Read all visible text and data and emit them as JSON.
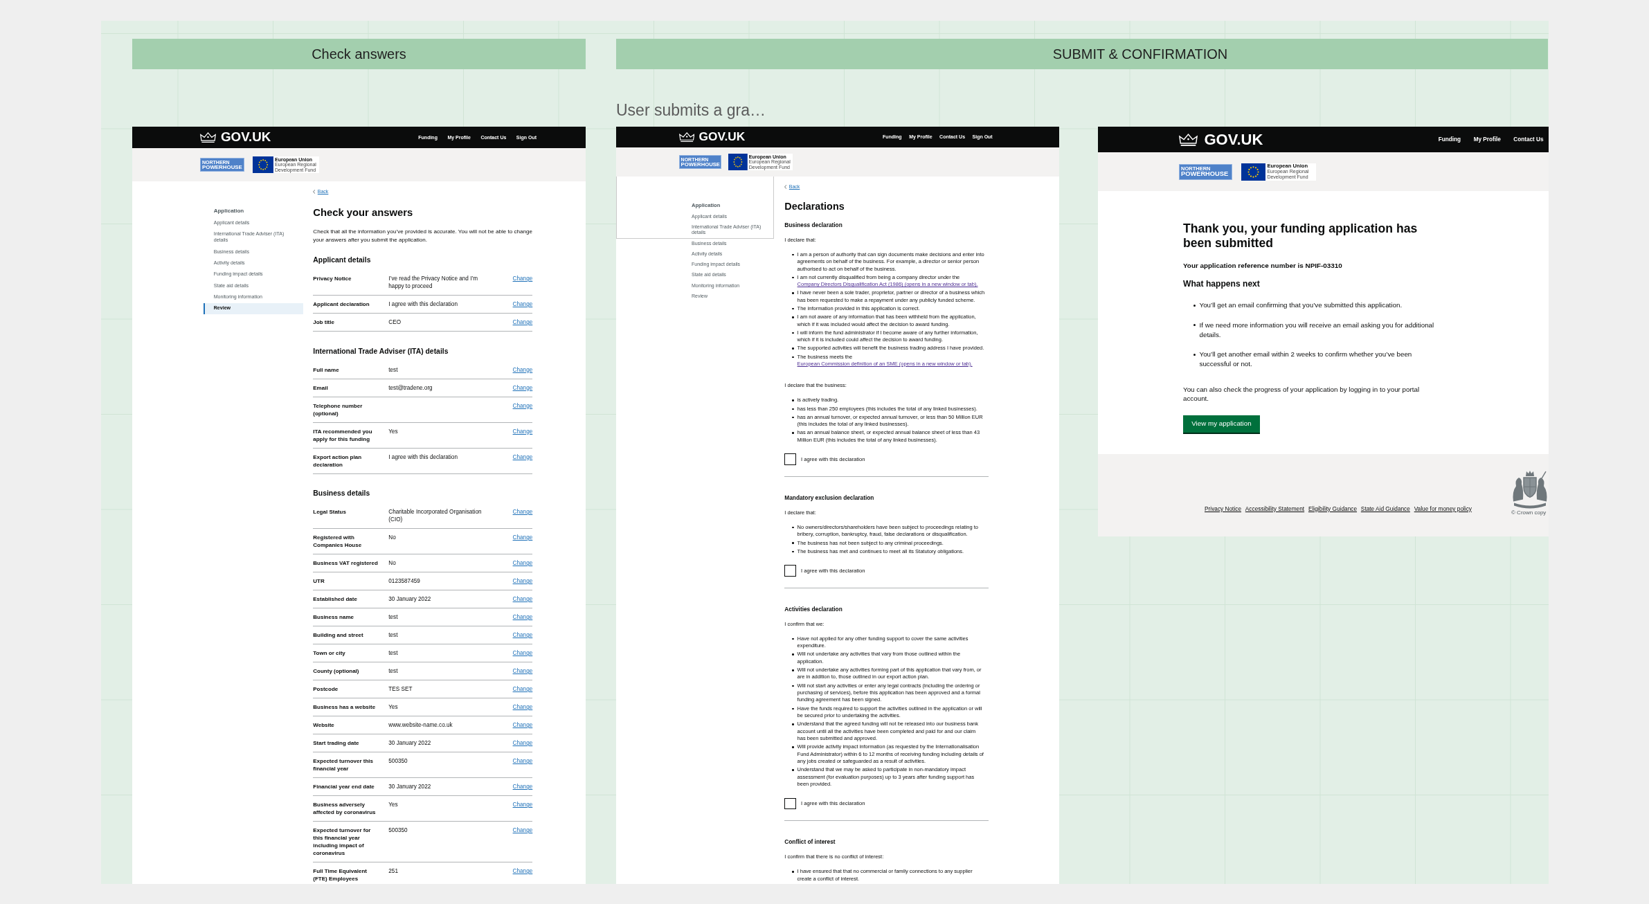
{
  "lanes": [
    {
      "title": "Check answers"
    },
    {
      "title": "SUBMIT & CONFIRMATION"
    }
  ],
  "caption": "User submits a gra…",
  "screens": [
    {
      "kind": "check_answers",
      "header": {
        "logo": "GOV.UK",
        "nav": [
          "Funding",
          "My Profile",
          "Contact Us",
          "Sign Out"
        ]
      },
      "banner": {
        "partner": [
          "NORTHERN",
          "POWERHOUSE"
        ],
        "eu": [
          "European Union",
          "European Regional",
          "Development Fund"
        ]
      },
      "back_link": "Back",
      "sidebar": {
        "title": "Application",
        "items": [
          {
            "label": "Applicant details",
            "selected": false
          },
          {
            "label": "International Trade Adviser (ITA) details",
            "selected": false
          },
          {
            "label": "Business details",
            "selected": false
          },
          {
            "label": "Activity details",
            "selected": false
          },
          {
            "label": "Funding impact details",
            "selected": false
          },
          {
            "label": "State aid details",
            "selected": false
          },
          {
            "label": "Monitoring information",
            "selected": false
          },
          {
            "label": "Review",
            "selected": true
          }
        ]
      },
      "title": "Check your answers",
      "intro": "Check that all the information you’ve provided is accurate. You will not be able to change your answers after you submit the application.",
      "sections": [
        {
          "heading": "Applicant details",
          "rows": [
            {
              "key": "Privacy Notice",
              "value": "I’ve read the Privacy Notice and I’m happy to proceed",
              "action": "Change"
            },
            {
              "key": "Applicant declaration",
              "value": "I agree with this declaration",
              "action": "Change"
            },
            {
              "key": "Job title",
              "value": "CEO",
              "action": "Change"
            }
          ]
        },
        {
          "heading": "International Trade Adviser (ITA) details",
          "rows": [
            {
              "key": "Full name",
              "value": "test",
              "action": "Change"
            },
            {
              "key": "Email",
              "value": "test@tradene.org",
              "action": "Change"
            },
            {
              "key": "Telephone number (optional)",
              "action": "Change"
            },
            {
              "key": "ITA recommended you apply for this funding",
              "value": "Yes",
              "action": "Change"
            },
            {
              "key": "Export action plan declaration",
              "value": "I agree with this declaration",
              "action": "Change"
            }
          ]
        },
        {
          "heading": "Business details",
          "rows": [
            {
              "key": "Legal Status",
              "value": "Charitable Incorporated Organisation (CIO)",
              "action": "Change"
            },
            {
              "key": "Registered with Companies House",
              "value": "No",
              "action": "Change"
            },
            {
              "key": "Business VAT registered",
              "value": "No",
              "action": "Change"
            },
            {
              "key": "UTR",
              "value": "0123587459",
              "action": "Change"
            },
            {
              "key": "Established date",
              "value": "30 January 2022",
              "action": "Change"
            },
            {
              "key": "Business name",
              "value": "test",
              "action": "Change"
            },
            {
              "key": "Building and street",
              "value": "test",
              "action": "Change"
            },
            {
              "key": "Town or city",
              "value": "test",
              "action": "Change"
            },
            {
              "key": "County (optional)",
              "value": "test",
              "action": "Change"
            },
            {
              "key": "Postcode",
              "value": "TES SET",
              "action": "Change"
            },
            {
              "key": "Business has a website",
              "value": "Yes",
              "action": "Change"
            },
            {
              "key": "Website",
              "value": "www.website-name.co.uk",
              "action": "Change"
            },
            {
              "key": "Start trading date",
              "value": "30 January 2022",
              "action": "Change"
            },
            {
              "key": "Expected turnover this financial year",
              "value": "500350",
              "action": "Change"
            },
            {
              "key": "Financial year end date",
              "value": "30 January 2022",
              "action": "Change"
            },
            {
              "key": "Business adversely affected by coronavirus",
              "value": "Yes",
              "action": "Change"
            },
            {
              "key": "Expected turnover for this financial year including impact of coronavirus",
              "value": "500350",
              "action": "Change"
            },
            {
              "key": "Full Time Equivalent (FTE) Employees",
              "value": "251",
              "action": "Change"
            }
          ]
        }
      ]
    },
    {
      "kind": "declarations",
      "header": {
        "logo": "GOV.UK",
        "nav": [
          "Funding",
          "My Profile",
          "Contact Us",
          "Sign Out"
        ]
      },
      "banner": {
        "partner": [
          "NORTHERN",
          "POWERHOUSE"
        ],
        "eu": [
          "European Union",
          "European Regional",
          "Development Fund"
        ]
      },
      "back_link": "Back",
      "sidebar": {
        "title": "Application",
        "items": [
          {
            "label": "Applicant details",
            "selected": false
          },
          {
            "label": "International Trade Adviser (ITA) details",
            "selected": false
          },
          {
            "label": "Business details",
            "selected": false
          },
          {
            "label": "Activity details",
            "selected": false
          },
          {
            "label": "Funding impact details",
            "selected": false
          },
          {
            "label": "State aid details",
            "selected": false
          },
          {
            "label": "Monitoring information",
            "selected": false
          },
          {
            "label": "Review",
            "selected": false
          }
        ]
      },
      "title": "Declarations",
      "sections": [
        {
          "heading": "Business declaration",
          "groups": [
            {
              "lead": "I declare that:",
              "items": [
                {
                  "text": "I am a person of authority that can sign documents make decisions and enter into agreements on behalf of the business. For example, a director or senior person authorised to act on behalf of the business."
                },
                {
                  "text": "I am not currently disqualified from being a company director under the",
                  "link": "Company Directors Disqualification Act (1986) (opens in a new window or tab)."
                },
                {
                  "text": "I have never been a sole trader, proprietor, partner or director of a business which has been requested to make a repayment under any publicly funded scheme."
                },
                {
                  "text": "The information provided in this application is correct."
                },
                {
                  "text": "I am not aware of any information that has been withheld from the application, which if it was included would affect the decision to award funding."
                },
                {
                  "text": "I will inform the fund administrator if I become aware of any further information, which if it is included could affect the decision to award funding."
                },
                {
                  "text": "The supported activities will benefit the business trading address I have provided."
                },
                {
                  "text": "The business meets the",
                  "link": "European Commission definition of an SME (opens in a new window or tab)."
                }
              ]
            },
            {
              "lead": "I declare that the business:",
              "items": [
                {
                  "text": "is actively trading."
                },
                {
                  "text": "has less than 250 employees (this includes the total of any linked businesses)."
                },
                {
                  "text": "has an annual turnover, or expected annual turnover, or less than 50 Million EUR (this includes the total of any linked businesses)."
                },
                {
                  "text": "has an annual balance sheet, or expected annual balance sheet of less than 43 Million EUR (this includes the total of any linked businesses)."
                }
              ]
            }
          ],
          "checkbox": {
            "label": "I agree with this declaration",
            "checked": false
          }
        },
        {
          "heading": "Mandatory exclusion declaration",
          "groups": [
            {
              "lead": "I declare that:",
              "items": [
                {
                  "text": "No owners/directors/shareholders have been subject to proceedings relating to bribery, corruption, bankruptcy, fraud, false declarations or disqualification."
                },
                {
                  "text": "The business has not been subject to any criminal proceedings."
                },
                {
                  "text": "The business has met and continues to meet all its Statutory obligations."
                }
              ]
            }
          ],
          "checkbox": {
            "label": "I agree with this declaration",
            "checked": false
          }
        },
        {
          "heading": "Activities declaration",
          "groups": [
            {
              "lead": "I confirm that we:",
              "items": [
                {
                  "text": "Have not applied for any other funding support to cover the same activities expenditure."
                },
                {
                  "text": "Will not undertake any activities that vary from those outlined within the application."
                },
                {
                  "text": "Will not undertake any activities forming part of this application that vary from, or are in addition to, those outlined in our export action plan."
                },
                {
                  "text": "Will not start any activities or enter any legal contracts (including the ordering or purchasing of services), before this application has been approved and a formal funding agreement has been signed."
                },
                {
                  "text": "Have the funds required to support the activities outlined in the application or will be secured prior to undertaking the activities."
                },
                {
                  "text": "Understand that the agreed funding will not be released into our business bank account until all the activities have been completed and paid for and our claim has been submitted and approved."
                },
                {
                  "text": "Will provide activity impact information (as requested by the Internationalisation Fund Administrator) within 6 to 12 months of receiving funding including details of any jobs created or safeguarded as a result of activities."
                },
                {
                  "text": "Understand that we may be asked to participate in non-mandatory impact assessment (for evaluation purposes) up to 3 years after funding support has been provided."
                }
              ]
            }
          ],
          "checkbox": {
            "label": "I agree with this declaration",
            "checked": false
          }
        },
        {
          "heading": "Conflict of interest",
          "groups": [
            {
              "lead": "I confirm that there is no conflict of interest:",
              "items": [
                {
                  "text": "I have ensured that that no commercial or family connections to any supplier create a conflict of interest."
                }
              ]
            }
          ]
        }
      ]
    },
    {
      "kind": "confirmation",
      "header": {
        "logo": "GOV.UK",
        "nav": [
          "Funding",
          "My Profile",
          "Contact Us"
        ]
      },
      "banner": {
        "partner": [
          "NORTHERN",
          "POWERHOUSE"
        ],
        "eu": [
          "European Union",
          "European Regional",
          "Development Fund"
        ]
      },
      "title": "Thank you, your funding application has been submitted",
      "reference": "Your application reference number is NPIF-03310",
      "subheading": "What happens next",
      "items": [
        "You’ll get an email confirming that you’ve submitted this application.",
        "If we need more information you will receive an email asking you for additional details.",
        "You’ll get another email within 2 weeks to confirm whether you’ve been successful or not."
      ],
      "note": "You can also check the progress of your application by logging in to your portal account.",
      "button": "View my application",
      "footer": {
        "links": [
          "Privacy Notice",
          "Accessibility Statement",
          "Eligibility Guidance",
          "State Aid Guidance",
          "Value for money policy"
        ],
        "copyright": "© Crown copy"
      }
    }
  ]
}
